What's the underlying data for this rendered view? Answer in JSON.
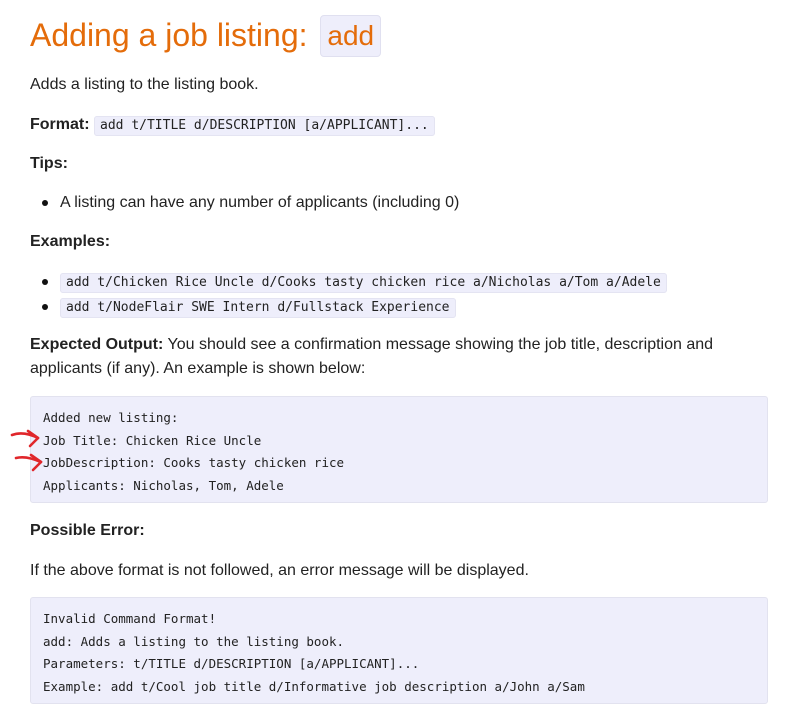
{
  "heading": {
    "text": "Adding a job listing:",
    "code": "add"
  },
  "intro": "Adds a listing to the listing book.",
  "format": {
    "label": "Format:",
    "code": "add t/TITLE d/DESCRIPTION [a/APPLICANT]..."
  },
  "tips": {
    "label": "Tips:",
    "items": [
      "A listing can have any number of applicants (including 0)"
    ]
  },
  "examples": {
    "label": "Examples:",
    "items": [
      "add t/Chicken Rice Uncle d/Cooks tasty chicken rice a/Nicholas a/Tom a/Adele",
      "add t/NodeFlair SWE Intern d/Fullstack Experience"
    ]
  },
  "expected_output": {
    "label": "Expected Output:",
    "text_line1": " You should see a confirmation message showing the job title, description and",
    "text_line2": "applicants (if any). An example is shown below:",
    "lines": [
      "Added new listing:",
      "Job Title: Chicken Rice Uncle",
      "JobDescription: Cooks tasty chicken rice",
      "Applicants: Nicholas, Tom, Adele"
    ]
  },
  "possible_error": {
    "label": "Possible Error:",
    "text": "If the above format is not followed, an error message will be displayed.",
    "lines": [
      "Invalid Command Format!",
      "add: Adds a listing to the listing book.",
      "Parameters: t/TITLE d/DESCRIPTION [a/APPLICANT]...",
      "Example: add t/Cool job title d/Informative job description a/John a/Sam"
    ]
  },
  "colors": {
    "heading": "#e46c0a",
    "code_bg": "#eeeefb",
    "annotation_arrow": "#e0262b"
  },
  "icons": [
    "red-arrow-icon"
  ]
}
